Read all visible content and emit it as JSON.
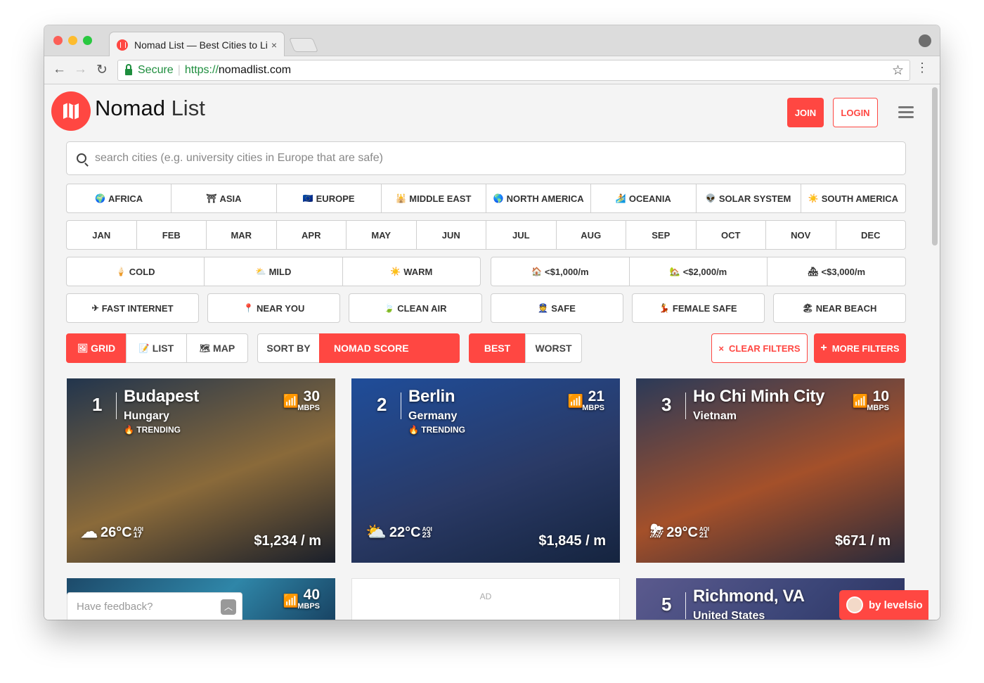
{
  "browser": {
    "tab_title": "Nomad List — Best Cities to Li",
    "tab_close": "×",
    "secure_label": "Secure",
    "url_scheme": "https://",
    "url_host": "nomadlist.com"
  },
  "header": {
    "brand_bold": "Nomad",
    "brand_light": "List",
    "join_label": "JOIN",
    "login_label": "LOGIN"
  },
  "search": {
    "placeholder": "search cities (e.g. university cities in Europe that are safe)"
  },
  "regions": [
    {
      "icon": "🌍",
      "label": "AFRICA"
    },
    {
      "icon": "⛩",
      "label": "ASIA"
    },
    {
      "icon": "🇪🇺",
      "label": "EUROPE"
    },
    {
      "icon": "🕌",
      "label": "MIDDLE EAST"
    },
    {
      "icon": "🌎",
      "label": "NORTH AMERICA"
    },
    {
      "icon": "🏄",
      "label": "OCEANIA"
    },
    {
      "icon": "👽",
      "label": "SOLAR SYSTEM"
    },
    {
      "icon": "☀️",
      "label": "SOUTH AMERICA"
    }
  ],
  "months": [
    "JAN",
    "FEB",
    "MAR",
    "APR",
    "MAY",
    "JUN",
    "JUL",
    "AUG",
    "SEP",
    "OCT",
    "NOV",
    "DEC"
  ],
  "climate": [
    {
      "icon": "🍦",
      "label": "COLD"
    },
    {
      "icon": "⛅",
      "label": "MILD"
    },
    {
      "icon": "☀️",
      "label": "WARM"
    }
  ],
  "budget": [
    {
      "icon": "🏠",
      "label": "<$1,000/m"
    },
    {
      "icon": "🏡",
      "label": "<$2,000/m"
    },
    {
      "icon": "🏘",
      "label": "<$3,000/m"
    }
  ],
  "features": [
    {
      "icon": "✈",
      "label": "FAST INTERNET"
    },
    {
      "icon": "📍",
      "label": "NEAR YOU"
    },
    {
      "icon": "🍃",
      "label": "CLEAN AIR"
    },
    {
      "icon": "👮",
      "label": "SAFE"
    },
    {
      "icon": "💃",
      "label": "FEMALE SAFE"
    },
    {
      "icon": "🏖",
      "label": "NEAR BEACH"
    }
  ],
  "view": {
    "grid": {
      "icon": "🖼",
      "label": "GRID"
    },
    "list": {
      "icon": "📝",
      "label": "LIST"
    },
    "map": {
      "icon": "🗺",
      "label": "MAP"
    }
  },
  "sort": {
    "label": "SORT BY",
    "value": "NOMAD SCORE",
    "best": "BEST",
    "worst": "WORST"
  },
  "filters": {
    "clear": "CLEAR FILTERS",
    "clear_icon": "×",
    "more": "MORE FILTERS",
    "more_icon": "+"
  },
  "cities": [
    {
      "rank": "1",
      "name": "Budapest",
      "country": "Hungary",
      "trending": "TRENDING",
      "mbps": "30",
      "mbps_unit": "MBPS",
      "weather": "cloud-icon",
      "temp": "26°C",
      "aqi_label": "AQI",
      "aqi": "17",
      "price": "$1,234 / m",
      "colors": [
        "#22354d",
        "#8a6a3a",
        "#1a1f2a"
      ]
    },
    {
      "rank": "2",
      "name": "Berlin",
      "country": "Germany",
      "trending": "TRENDING",
      "mbps": "21",
      "mbps_unit": "MBPS",
      "weather": "sun-cloud-icon",
      "temp": "22°C",
      "aqi_label": "AQI",
      "aqi": "23",
      "price": "$1,845 / m",
      "colors": [
        "#1f4d9a",
        "#2a3a66",
        "#15243f"
      ]
    },
    {
      "rank": "3",
      "name": "Ho Chi Minh City",
      "country": "Vietnam",
      "trending": "",
      "mbps": "10",
      "mbps_unit": "MBPS",
      "weather": "storm-cloud-icon",
      "temp": "29°C",
      "aqi_label": "AQI",
      "aqi": "21",
      "price": "$671 / m",
      "colors": [
        "#2b3a58",
        "#a4502a",
        "#2a2a3a"
      ]
    }
  ],
  "partial_cards": [
    {
      "mbps": "40",
      "mbps_unit": "MBPS"
    },
    {
      "rank": "5",
      "name": "Richmond, VA",
      "country": "United States"
    }
  ],
  "ad_label": "AD",
  "feedback_placeholder": "Have feedback?",
  "levelsio_label": "by levelsio",
  "colors": {
    "accent": "#ff4742"
  }
}
